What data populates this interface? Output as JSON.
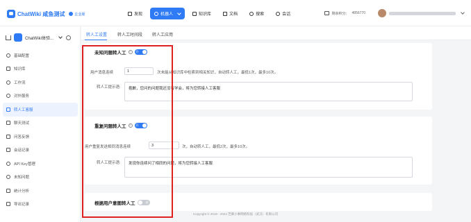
{
  "header": {
    "brand_name": "ChatWiki 咸鱼测试",
    "brand_tag": "企业版",
    "nav": [
      {
        "label": "发现",
        "icon": "home-icon",
        "active": false
      },
      {
        "label": "机器人",
        "icon": "robot-icon",
        "active": true
      },
      {
        "label": "知识库",
        "icon": "book-icon",
        "active": false
      },
      {
        "label": "文档",
        "icon": "doc-icon",
        "active": false
      },
      {
        "label": "搜索",
        "icon": "search-icon",
        "active": false
      },
      {
        "label": "会话",
        "icon": "chat-icon",
        "active": false
      }
    ],
    "quota_label": "剩余积分：",
    "quota_value": "4856770"
  },
  "sidebar": {
    "robot_name": "ChatWiki体验...",
    "items": [
      {
        "label": "基础配置",
        "icon": "settings-icon",
        "active": false
      },
      {
        "label": "知识库",
        "icon": "book-icon",
        "active": false
      },
      {
        "label": "工作流",
        "icon": "workflow-icon",
        "active": false
      },
      {
        "label": "对外服务",
        "icon": "service-icon",
        "active": false
      },
      {
        "label": "转人工客服",
        "icon": "agent-icon",
        "active": true
      },
      {
        "label": "聊天测试",
        "icon": "chat-test-icon",
        "active": false
      },
      {
        "label": "问答反馈",
        "icon": "feedback-icon",
        "active": false
      },
      {
        "label": "会话记录",
        "icon": "record-icon",
        "active": false
      },
      {
        "label": "API Key管理",
        "icon": "key-icon",
        "active": false
      },
      {
        "label": "未知问题",
        "icon": "question-icon",
        "active": false
      },
      {
        "label": "统计分析",
        "icon": "stats-icon",
        "active": false
      },
      {
        "label": "导出记录",
        "icon": "export-icon",
        "active": false
      }
    ]
  },
  "tabs": [
    {
      "label": "转人工设置",
      "active": true
    },
    {
      "label": "转人工时间段",
      "active": false
    },
    {
      "label": "转人工应用",
      "active": false
    }
  ],
  "sections": {
    "unknown": {
      "title": "未知问题转人工",
      "toggle_text": "开",
      "enabled": true,
      "count_label": "用户消息连续",
      "count_value": "1",
      "count_suffix": "次未能从知识库中检索到相关知识，自动转人工，最低1次，最多10次。",
      "prompt_label": "转人工提示语:",
      "prompt_value": "抱歉，您问的问题我还没有学会，将为您转接人工客服"
    },
    "repeat": {
      "title": "重复问题转人工",
      "toggle_text": "开",
      "enabled": true,
      "count_label": "用户重复发送相同消息连续",
      "count_value": "3",
      "count_suffix": "次，自动转人工，最低2次，最多10次。",
      "prompt_label": "转人工提示语:",
      "prompt_value": "发现你连续问了相同的问题，将为您转接人工客服"
    },
    "intent": {
      "title": "根据用户意图转人工",
      "toggle_text": "关",
      "enabled": false
    }
  },
  "footer": "Copyright © 2018 - 2024 芝麻小事网络科技（武汉）有限公司",
  "colors": {
    "accent": "#2f7bf5",
    "highlight_box": "#e02020"
  }
}
